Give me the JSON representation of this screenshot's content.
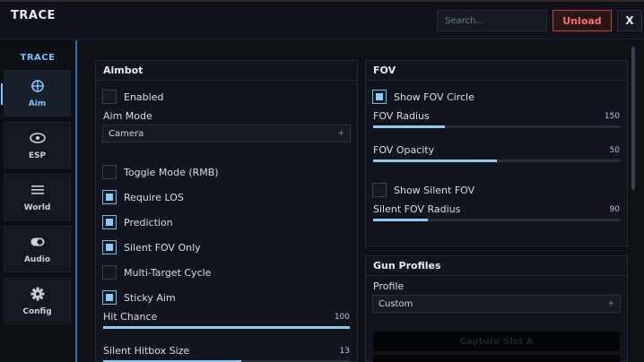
{
  "app": {
    "title": "TRACE"
  },
  "topbar": {
    "search_placeholder": "Search...",
    "unload_label": "Unload",
    "close_label": "X"
  },
  "sidebar": {
    "title": "TRACE",
    "items": [
      {
        "label": "Aim",
        "icon": "crosshair-icon",
        "active": true
      },
      {
        "label": "ESP",
        "icon": "eye-icon",
        "active": false
      },
      {
        "label": "World",
        "icon": "menu-lines-icon",
        "active": false
      },
      {
        "label": "Audio",
        "icon": "toggle-icon",
        "active": false
      },
      {
        "label": "Config",
        "icon": "gear-icon",
        "active": false
      }
    ]
  },
  "aimbot": {
    "title": "Aimbot",
    "enabled": {
      "label": "Enabled",
      "checked": false
    },
    "aim_mode": {
      "label": "Aim Mode",
      "value": "Camera"
    },
    "toggle_mode": {
      "label": "Toggle Mode (RMB)",
      "checked": false
    },
    "require_los": {
      "label": "Require LOS",
      "checked": true
    },
    "prediction": {
      "label": "Prediction",
      "checked": true
    },
    "silent_fov_only": {
      "label": "Silent FOV Only",
      "checked": true
    },
    "multi_target_cycle": {
      "label": "Multi-Target Cycle",
      "checked": false
    },
    "sticky_aim": {
      "label": "Sticky Aim",
      "checked": true
    },
    "hit_chance": {
      "label": "Hit Chance",
      "value": "100",
      "fraction": 1.0
    },
    "silent_hitbox_size": {
      "label": "Silent Hitbox Size",
      "value": "13",
      "fraction": 0.56
    }
  },
  "fov": {
    "title": "FOV",
    "show_fov_circle": {
      "label": "Show FOV Circle",
      "checked": true
    },
    "fov_radius": {
      "label": "FOV Radius",
      "value": "150",
      "fraction": 0.29
    },
    "fov_opacity": {
      "label": "FOV Opacity",
      "value": "50",
      "fraction": 0.5
    },
    "show_silent_fov": {
      "label": "Show Silent FOV",
      "checked": false
    },
    "silent_fov_radius": {
      "label": "Silent FOV Radius",
      "value": "90",
      "fraction": 0.22
    }
  },
  "gun_profiles": {
    "title": "Gun Profiles",
    "profile": {
      "label": "Profile",
      "value": "Custom"
    },
    "capture_slot_a": "Capture Slot A"
  },
  "colors": {
    "accent": "#8ccaf9",
    "danger": "#ff6e6e",
    "panel": "#12161c"
  }
}
